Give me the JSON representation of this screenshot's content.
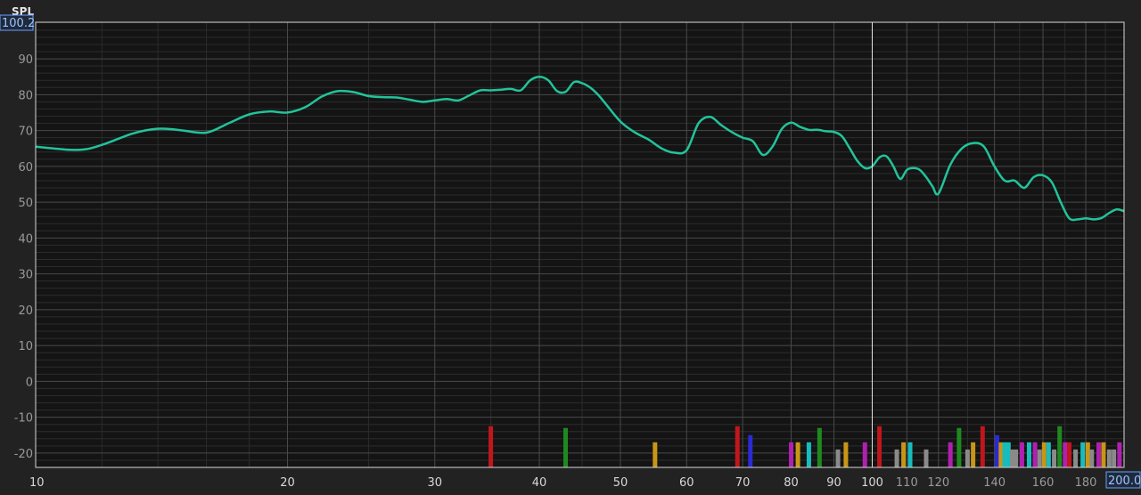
{
  "chart_data": {
    "type": "line",
    "title": "",
    "xlabel": "",
    "ylabel": "SPL",
    "x_scale": "log",
    "xlim": [
      10,
      200
    ],
    "ylim": [
      -24,
      100.2
    ],
    "y_top_readout": "100.2",
    "x_right_readout": "200.0",
    "grid": true,
    "legend": "none",
    "y_ticks": [
      90,
      80,
      70,
      60,
      50,
      40,
      30,
      20,
      10,
      0,
      -10,
      -20
    ],
    "x_ticks": [
      10,
      20,
      30,
      40,
      50,
      60,
      70,
      80,
      90,
      100,
      110,
      120,
      140,
      160,
      180
    ],
    "colors": {
      "background": "#222222",
      "plot_background": "#141414",
      "grid_major": "#4a4a4a",
      "grid_minor": "#2c2c2c",
      "trace": "#22c39a",
      "cursor": "#e0e0e0",
      "readout_border": "#6aa0ff"
    },
    "series": [
      {
        "x": [
          10,
          10.5,
          11,
          11.5,
          12,
          12.5,
          13,
          13.5,
          14,
          14.5,
          15,
          16,
          17,
          18,
          19,
          20,
          21,
          22,
          23,
          24,
          25,
          26,
          27,
          28,
          29,
          30,
          31,
          32,
          33,
          34,
          35,
          36,
          37,
          38,
          39,
          40,
          41,
          42,
          43,
          44,
          45,
          46,
          47,
          48,
          50,
          52,
          54,
          56,
          58,
          60,
          62,
          64,
          66,
          68,
          70,
          72,
          74,
          76,
          78,
          80,
          82,
          84,
          86,
          88,
          90,
          92,
          94,
          96,
          98,
          100,
          102,
          104,
          106,
          108,
          110,
          112,
          114,
          116,
          118,
          120,
          124,
          128,
          132,
          136,
          140,
          144,
          148,
          152,
          156,
          160,
          164,
          168,
          172,
          176,
          180,
          184,
          188,
          192,
          196,
          200
        ],
        "y": [
          65.5,
          65,
          64.6,
          64.8,
          66,
          67.5,
          69,
          70,
          70.5,
          70.4,
          70,
          69.4,
          72,
          74.5,
          75.3,
          75,
          76.5,
          79.5,
          81,
          80.7,
          79.6,
          79.3,
          79.2,
          78.6,
          78,
          78.4,
          78.8,
          78.4,
          79.8,
          81.2,
          81.2,
          81.4,
          81.6,
          81.2,
          84,
          85,
          84,
          81,
          80.8,
          83.5,
          83.2,
          82,
          80,
          77.5,
          72.5,
          69.5,
          67.5,
          65,
          63.8,
          64.5,
          72,
          73.8,
          71.5,
          69.5,
          68,
          67,
          63.2,
          65.5,
          70.5,
          72.2,
          71,
          70.2,
          70.2,
          69.8,
          69.6,
          68.4,
          65,
          61.5,
          59.5,
          60,
          62.5,
          62.8,
          60,
          56.5,
          59,
          59.5,
          59,
          57,
          54.5,
          52.4,
          60.5,
          65,
          66.5,
          65.5,
          60,
          56,
          56,
          54,
          57,
          57.5,
          55.5,
          50,
          45.5,
          45.2,
          45.5,
          45.2,
          45.6,
          47,
          48,
          47.5
        ]
      }
    ],
    "spectral_markers": [
      {
        "freq": 35,
        "level": -12.5,
        "color": "#c0161c"
      },
      {
        "freq": 43,
        "level": -13,
        "color": "#1e8a1e"
      },
      {
        "freq": 55,
        "level": -17,
        "color": "#c89616"
      },
      {
        "freq": 69,
        "level": -12.5,
        "color": "#c0161c"
      },
      {
        "freq": 71.5,
        "level": -15,
        "color": "#2a2ad6"
      },
      {
        "freq": 80,
        "level": -17,
        "color": "#b020b0"
      },
      {
        "freq": 81.5,
        "level": -17,
        "color": "#c89616"
      },
      {
        "freq": 84,
        "level": -17,
        "color": "#18bcbc"
      },
      {
        "freq": 86.5,
        "level": -13,
        "color": "#1e8a1e"
      },
      {
        "freq": 91,
        "level": -19,
        "color": "#8a8a8a"
      },
      {
        "freq": 93,
        "level": -17,
        "color": "#c89616"
      },
      {
        "freq": 98,
        "level": -17,
        "color": "#b020b0"
      },
      {
        "freq": 102,
        "level": -12.5,
        "color": "#c0161c"
      },
      {
        "freq": 107,
        "level": -19,
        "color": "#8a8a8a"
      },
      {
        "freq": 109,
        "level": -17,
        "color": "#c89616"
      },
      {
        "freq": 111,
        "level": -17,
        "color": "#18bcbc"
      },
      {
        "freq": 116,
        "level": -19,
        "color": "#8a8a8a"
      },
      {
        "freq": 124,
        "level": -17,
        "color": "#b020b0"
      },
      {
        "freq": 127,
        "level": -13,
        "color": "#1e8a1e"
      },
      {
        "freq": 130,
        "level": -19,
        "color": "#8a8a8a"
      },
      {
        "freq": 132,
        "level": -17,
        "color": "#c89616"
      },
      {
        "freq": 135.5,
        "level": -12.5,
        "color": "#c0161c"
      },
      {
        "freq": 141,
        "level": -15,
        "color": "#2a2ad6"
      },
      {
        "freq": 142.5,
        "level": -17,
        "color": "#c89616"
      },
      {
        "freq": 144,
        "level": -17,
        "color": "#18bcbc"
      },
      {
        "freq": 145.5,
        "level": -17,
        "color": "#18bcbc"
      },
      {
        "freq": 147,
        "level": -19,
        "color": "#8a8a8a"
      },
      {
        "freq": 148.5,
        "level": -19,
        "color": "#8a8a8a"
      },
      {
        "freq": 151,
        "level": -17,
        "color": "#b020b0"
      },
      {
        "freq": 154,
        "level": -17,
        "color": "#18bcbc"
      },
      {
        "freq": 156.5,
        "level": -17,
        "color": "#b020b0"
      },
      {
        "freq": 158.5,
        "level": -19,
        "color": "#8a8a8a"
      },
      {
        "freq": 160.5,
        "level": -17,
        "color": "#c89616"
      },
      {
        "freq": 162.5,
        "level": -17,
        "color": "#18bcbc"
      },
      {
        "freq": 165,
        "level": -19,
        "color": "#8a8a8a"
      },
      {
        "freq": 167.5,
        "level": -12.5,
        "color": "#1e8a1e"
      },
      {
        "freq": 170,
        "level": -17,
        "color": "#b020b0"
      },
      {
        "freq": 172,
        "level": -17,
        "color": "#c0161c"
      },
      {
        "freq": 175,
        "level": -19,
        "color": "#8a8a8a"
      },
      {
        "freq": 178.5,
        "level": -17,
        "color": "#18bcbc"
      },
      {
        "freq": 181,
        "level": -17,
        "color": "#c89616"
      },
      {
        "freq": 183,
        "level": -19,
        "color": "#8a8a8a"
      },
      {
        "freq": 186.5,
        "level": -17,
        "color": "#b020b0"
      },
      {
        "freq": 189,
        "level": -17,
        "color": "#c89616"
      },
      {
        "freq": 192,
        "level": -19,
        "color": "#8a8a8a"
      },
      {
        "freq": 194.5,
        "level": -19,
        "color": "#8a8a8a"
      },
      {
        "freq": 197.5,
        "level": -17,
        "color": "#b020b0"
      }
    ],
    "cursor_x": 100
  }
}
